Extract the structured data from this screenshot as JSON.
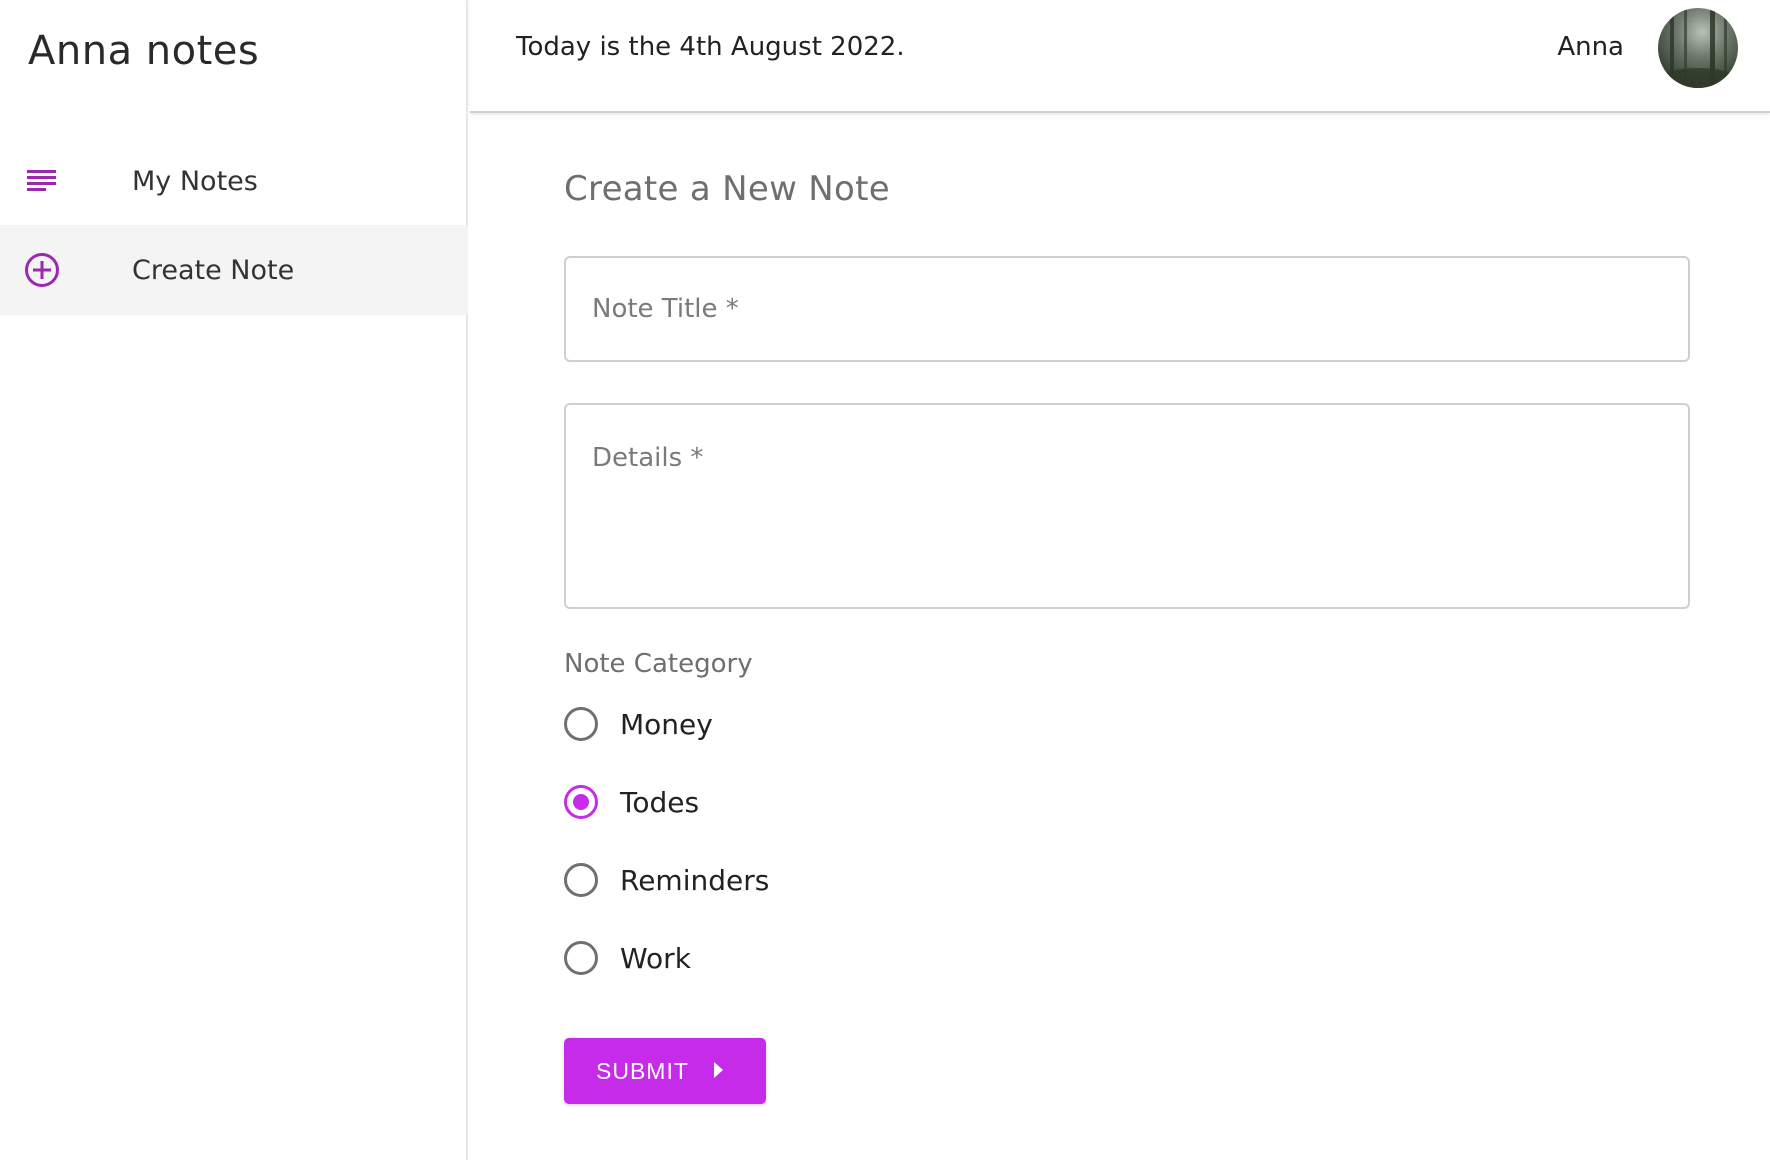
{
  "app": {
    "title": "Anna notes"
  },
  "sidebar": {
    "items": [
      {
        "label": "My Notes",
        "icon": "notes-list-icon"
      },
      {
        "label": "Create Note",
        "icon": "add-circle-icon"
      }
    ]
  },
  "header": {
    "date_text": "Today is the 4th August 2022.",
    "user_name": "Anna"
  },
  "form": {
    "title": "Create a New Note",
    "note_title_placeholder": "Note Title *",
    "details_placeholder": "Details *",
    "category_label": "Note Category",
    "categories": [
      {
        "label": "Money",
        "checked": false
      },
      {
        "label": "Todes",
        "checked": true
      },
      {
        "label": "Reminders",
        "checked": false
      },
      {
        "label": "Work",
        "checked": false
      }
    ],
    "submit_label": "SUBMIT"
  },
  "colors": {
    "accent": "#c72bea",
    "nav_icon": "#9c27b0",
    "active_nav_bg": "#f4f4f4"
  }
}
